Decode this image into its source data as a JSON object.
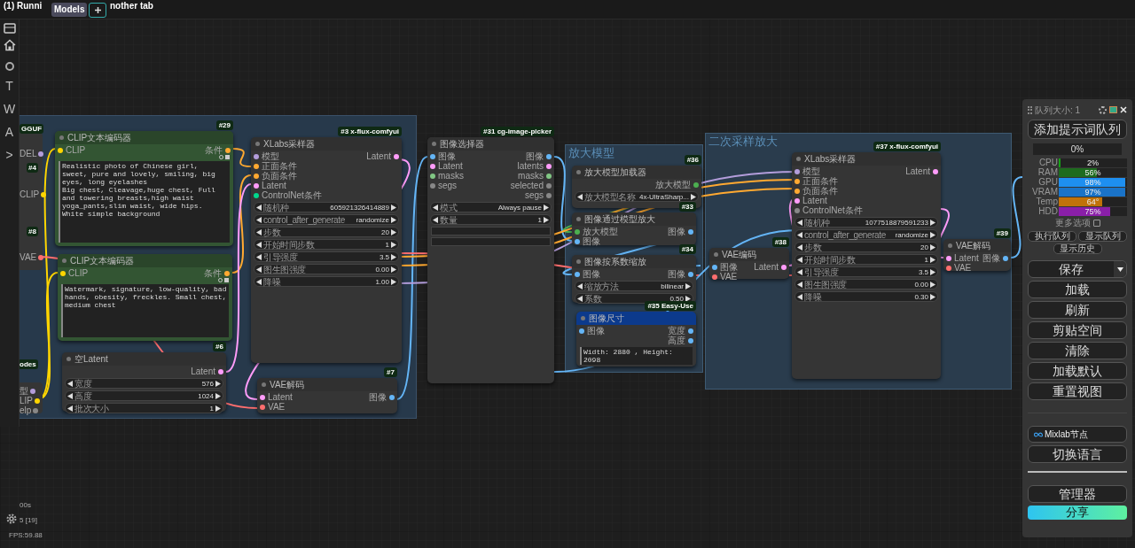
{
  "top_bar": {
    "title_fragment": "(1) Runni",
    "models_button": "Models",
    "tab_fragment": "nother tab"
  },
  "sidebar": {
    "items": [
      "T",
      "W",
      "A",
      ">"
    ]
  },
  "status": [
    "00s",
    "5 [19]",
    "FPS:59.88"
  ],
  "left_fragments": [
    {
      "kind": "badge",
      "text": "GGUF"
    },
    {
      "kind": "port",
      "text": "DEL",
      "color": "#b39ddb"
    },
    {
      "kind": "badge",
      "text": "#4"
    },
    {
      "kind": "port",
      "text": "CLIP",
      "color": "#ffd500"
    },
    {
      "kind": "badge",
      "text": "#8"
    },
    {
      "kind": "port",
      "text": "VAE",
      "color": "#ff6e6e"
    },
    {
      "kind": "badge",
      "text": "odes"
    },
    {
      "kind": "port",
      "text": "型",
      "color": "#b39ddb"
    },
    {
      "kind": "port",
      "text": "LIP",
      "color": "#ffd500"
    },
    {
      "kind": "port",
      "text": "elp",
      "color": "#888888"
    }
  ],
  "groups": [
    {
      "kind": "plain"
    },
    {
      "kind": "titled",
      "title": "放大模型"
    },
    {
      "kind": "titled",
      "title": "二次采样放大"
    }
  ],
  "nodes": [
    {
      "badge": "#29",
      "title": "CLIP文本编码器",
      "kind": "text",
      "inputs": [
        {
          "name": "CLIP",
          "color": "#ffd500"
        }
      ],
      "outputs": [
        {
          "name": "条件",
          "color": "#ffa931"
        }
      ],
      "text": "Realistic photo of Chinese girl, sweet, pure and lovely, smiling, big eyes, long eyelashes\nBig chest, Cleavage,huge chest, Full and towering breasts,high waist yoga_pants,slim waist, wide hips.\nWhite simple background"
    },
    {
      "title": "CLIP文本编码器",
      "kind": "text",
      "inputs": [
        {
          "name": "CLIP",
          "color": "#ffd500"
        }
      ],
      "outputs": [
        {
          "name": "条件",
          "color": "#ffa931"
        }
      ],
      "text": "Watermark, signature, low-quality, bad hands, obesity, freckles. Small chest, medium chest"
    },
    {
      "badge": "#3 x-flux-comfyui",
      "title": "XLabs采样器",
      "kind": "plain",
      "inputs": [
        {
          "name": "模型",
          "color": "#b39ddb"
        },
        {
          "name": "正面条件",
          "color": "#ffa931"
        },
        {
          "name": "负面条件",
          "color": "#ffa931"
        },
        {
          "name": "Latent",
          "color": "#ff9cf9"
        },
        {
          "name": "ControlNet条件",
          "color": "#00d78d"
        }
      ],
      "outputs": [
        {
          "name": "Latent",
          "color": "#ff9cf9"
        }
      ],
      "widgets": [
        {
          "label": "随机种",
          "value": "605921326414889"
        },
        {
          "label": "control_after_generate",
          "value": "randomize"
        },
        {
          "label": "步数",
          "value": "20"
        },
        {
          "label": "开始时间步数",
          "value": "1"
        },
        {
          "label": "引导强度",
          "value": "3.5"
        },
        {
          "label": "图生图强度",
          "value": "0.00"
        },
        {
          "label": "降噪",
          "value": "1.00"
        }
      ]
    },
    {
      "badge": "#6",
      "title": "空Latent",
      "kind": "plain",
      "outputs": [
        {
          "name": "Latent",
          "color": "#ff9cf9"
        }
      ],
      "widgets": [
        {
          "label": "宽度",
          "value": "576"
        },
        {
          "label": "高度",
          "value": "1024"
        },
        {
          "label": "批次大小",
          "value": "1"
        }
      ]
    },
    {
      "badge": "#7",
      "title": "VAE解码",
      "kind": "plain",
      "inputs": [
        {
          "name": "Latent",
          "color": "#ff9cf9"
        },
        {
          "name": "VAE",
          "color": "#ff6e6e"
        }
      ],
      "outputs": [
        {
          "name": "图像",
          "color": "#64b5f6"
        }
      ]
    },
    {
      "badge": "#31 cg-image-picker",
      "title": "图像选择器",
      "kind": "picker",
      "inputs": [
        {
          "name": "图像",
          "color": "#64b5f6"
        },
        {
          "name": "Latent",
          "color": "#ff9cf9"
        },
        {
          "name": "masks",
          "color": "#81c784"
        },
        {
          "name": "segs",
          "color": "#888888"
        }
      ],
      "outputs": [
        {
          "name": "图像",
          "color": "#64b5f6"
        },
        {
          "name": "latents",
          "color": "#ff9cf9"
        },
        {
          "name": "masks",
          "color": "#81c784"
        },
        {
          "name": "selected",
          "color": "#888888"
        },
        {
          "name": "segs",
          "color": "#888888"
        }
      ],
      "widgets": [
        {
          "label": "模式",
          "value": "Always pause"
        },
        {
          "label": "数量",
          "value": "1"
        }
      ]
    },
    {
      "badge": "#36",
      "title": "放大模型加载器",
      "kind": "plain",
      "outputs": [
        {
          "name": "放大模型",
          "color": "#4caf50"
        }
      ],
      "widgets": [
        {
          "label": "放大模型名称",
          "value": "4x-UltraSharp..."
        }
      ]
    },
    {
      "badge": "#33",
      "title": "图像通过模型放大",
      "kind": "plain",
      "inputs": [
        {
          "name": "放大模型",
          "color": "#4caf50"
        },
        {
          "name": "图像",
          "color": "#64b5f6"
        }
      ],
      "outputs": [
        {
          "name": "图像",
          "color": "#64b5f6"
        }
      ]
    },
    {
      "badge": "#34",
      "title": "图像按系数缩放",
      "kind": "plain",
      "inputs": [
        {
          "name": "图像",
          "color": "#64b5f6"
        }
      ],
      "outputs": [
        {
          "name": "图像",
          "color": "#64b5f6"
        }
      ],
      "widgets": [
        {
          "label": "缩放方法",
          "value": "bilinear"
        },
        {
          "label": "系数",
          "value": "0.50"
        }
      ]
    },
    {
      "badge": "#35 Easy-Use",
      "title": "图像尺寸",
      "kind": "info",
      "inputs": [
        {
          "name": "图像",
          "color": "#64b5f6"
        }
      ],
      "outputs": [
        {
          "name": "宽度",
          "color": "#64b5f6"
        },
        {
          "name": "高度",
          "color": "#64b5f6"
        }
      ],
      "text": "Width: 2880 , Height: 2098"
    },
    {
      "badge": "#38",
      "title": "VAE编码",
      "kind": "plain",
      "inputs": [
        {
          "name": "图像",
          "color": "#64b5f6"
        },
        {
          "name": "VAE",
          "color": "#ff6e6e"
        }
      ],
      "outputs": [
        {
          "name": "Latent",
          "color": "#ff9cf9"
        }
      ]
    },
    {
      "badge": "#37 x-flux-comfyui",
      "title": "XLabs采样器",
      "kind": "plain",
      "inputs": [
        {
          "name": "模型",
          "color": "#b39ddb"
        },
        {
          "name": "正面条件",
          "color": "#ffa931"
        },
        {
          "name": "负面条件",
          "color": "#ffa931"
        },
        {
          "name": "Latent",
          "color": "#ff9cf9"
        },
        {
          "name": "ControlNet条件",
          "color": "#888888"
        }
      ],
      "outputs": [
        {
          "name": "Latent",
          "color": "#ff9cf9"
        }
      ],
      "widgets": [
        {
          "label": "随机种",
          "value": "1077518879591233"
        },
        {
          "label": "control_after_generate",
          "value": "randomize"
        },
        {
          "label": "步数",
          "value": "20"
        },
        {
          "label": "开始时间步数",
          "value": "1"
        },
        {
          "label": "引导强度",
          "value": "3.5"
        },
        {
          "label": "图生图强度",
          "value": "0.00"
        },
        {
          "label": "降噪",
          "value": "0.30"
        }
      ]
    },
    {
      "badge": "#39",
      "title": "VAE解码",
      "kind": "plain",
      "inputs": [
        {
          "name": "Latent",
          "color": "#ff9cf9"
        },
        {
          "name": "VAE",
          "color": "#ff6e6e"
        }
      ],
      "outputs": [
        {
          "name": "图像",
          "color": "#64b5f6"
        }
      ]
    }
  ],
  "panel": {
    "queue_label": "队列大小: 1",
    "add_queue": "添加提示词队列",
    "progress": {
      "reading": "0%",
      "level": 0
    },
    "meters": [
      {
        "name": "CPU",
        "reading": "2%",
        "level": 0.02,
        "color": "#16a316"
      },
      {
        "name": "RAM",
        "reading": "56%",
        "level": 0.56,
        "color": "#1e6b1e"
      },
      {
        "name": "GPU",
        "reading": "98%",
        "level": 0.98,
        "color": "#1e8ff0"
      },
      {
        "name": "VRAM",
        "reading": "97%",
        "level": 0.97,
        "color": "#1a73c8"
      },
      {
        "name": "Temp",
        "reading": "64°",
        "level": 0.64,
        "color": "#c0720a"
      },
      {
        "name": "HDD",
        "reading": "75%",
        "level": 0.75,
        "color": "#8a1fa8"
      }
    ],
    "more_options": {
      "label": "更多选项",
      "checked": false
    },
    "small_buttons": [
      "执行队列",
      "显示队列",
      "显示历史"
    ],
    "save_button": "保存",
    "buttons": [
      "加载",
      "刷新",
      "剪贴空间",
      "清除",
      "加载默认",
      "重置视图"
    ],
    "mixlab_button": "Mixlab节点",
    "language_button": "切换语言",
    "manager_button": "管理器",
    "share_button": "分享"
  }
}
